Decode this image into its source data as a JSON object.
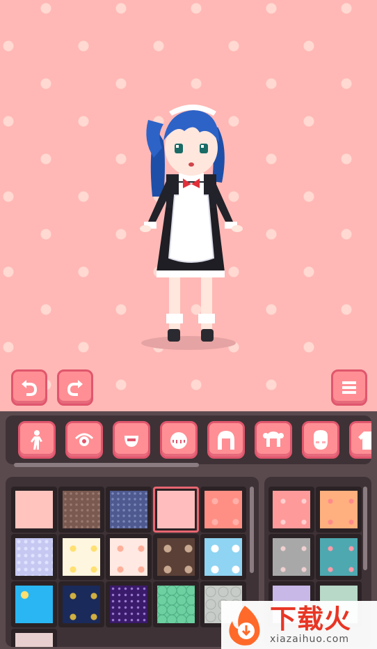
{
  "toolbar": {
    "undo_icon": "undo-arrow-icon",
    "redo_icon": "redo-arrow-icon",
    "menu_icon": "menu-hamburger-icon"
  },
  "categories": [
    {
      "icon": "body-pose-icon"
    },
    {
      "icon": "eye-icon"
    },
    {
      "icon": "mouth-icon"
    },
    {
      "icon": "bangs-hair-icon"
    },
    {
      "icon": "long-hair-icon"
    },
    {
      "icon": "twin-hair-icon"
    },
    {
      "icon": "face-blush-icon"
    },
    {
      "icon": "outfit-icon"
    }
  ],
  "patterns": {
    "selected_index": 3,
    "tiles": [
      {
        "name": "plain-pink",
        "color": "#ffc4bd"
      },
      {
        "name": "brown-dots",
        "color": "#7a5a50"
      },
      {
        "name": "navy-dots",
        "color": "#4e5a8f"
      },
      {
        "name": "pink-hearts",
        "color": "#ffbebd"
      },
      {
        "name": "coral-bows",
        "color": "#ff8f84"
      },
      {
        "name": "lavender-lattice",
        "color": "#c6c8f2"
      },
      {
        "name": "cream-lemons",
        "color": "#fff6e0"
      },
      {
        "name": "peach-fruit",
        "color": "#ffe9e2"
      },
      {
        "name": "brown-cookies",
        "color": "#5a4036"
      },
      {
        "name": "sky-clouds",
        "color": "#8fd4f2"
      },
      {
        "name": "blue-sun",
        "color": "#29b6f2"
      },
      {
        "name": "navy-stars",
        "color": "#1a2a5a"
      },
      {
        "name": "purple-stars",
        "color": "#3a1a6a"
      },
      {
        "name": "mint-scales",
        "color": "#6cd0a0"
      },
      {
        "name": "grey-tiles",
        "color": "#c8ccc8"
      }
    ]
  },
  "colors": {
    "tiles": [
      {
        "name": "salmon-hearts",
        "color": "#ff9a9a"
      },
      {
        "name": "orange-hearts",
        "color": "#ffb07e"
      },
      {
        "name": "grey-hearts",
        "color": "#a8a8a8"
      },
      {
        "name": "teal-hearts",
        "color": "#4ea8b0"
      }
    ]
  },
  "watermark": {
    "title": "下载火",
    "url": "xiazaihuo.com"
  }
}
